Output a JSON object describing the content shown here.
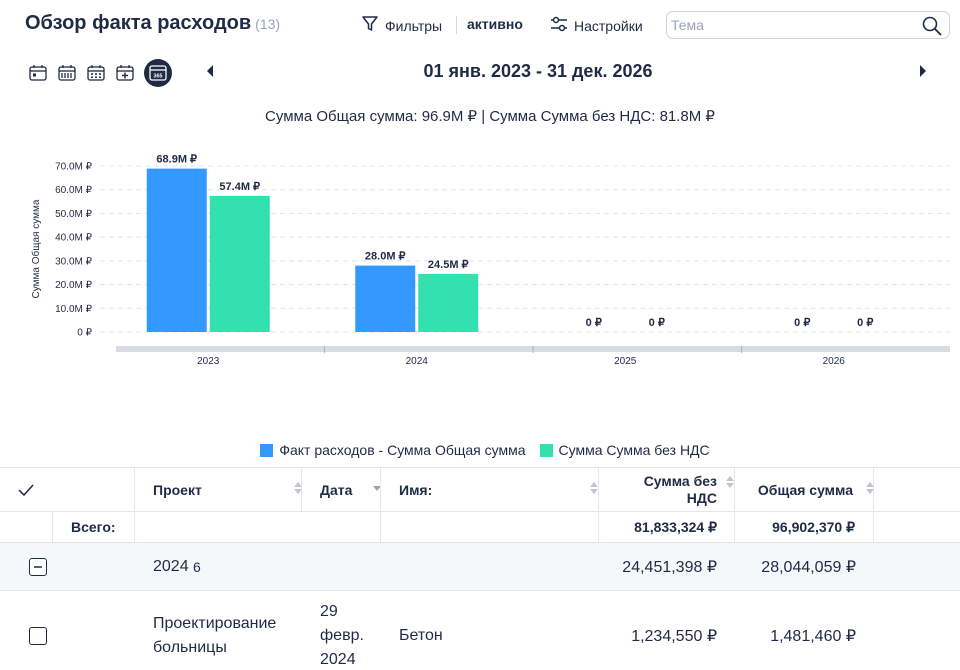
{
  "header": {
    "title": "Обзор факта расходов",
    "count": "(13)",
    "filters_label": "Фильтры",
    "filters_status": "активно",
    "settings_label": "Настройки",
    "search_placeholder": "Тема"
  },
  "period": {
    "range": "01 янв. 2023 - 31 дек. 2026",
    "icons": [
      "calendar-day-icon",
      "calendar-week-icon",
      "calendar-month-icon",
      "calendar-custom-icon",
      "calendar-year-icon"
    ],
    "active_icon_label": "365"
  },
  "chart_summary": "Сумма Общая сумма: 96.9M ₽ | Сумма Сумма без НДС: 81.8M ₽",
  "chart_data": {
    "type": "bar",
    "categories": [
      "2023",
      "2024",
      "2025",
      "2026"
    ],
    "series": [
      {
        "name": "Факт расходов - Сумма Общая сумма",
        "values": [
          68.9,
          28.0,
          0,
          0
        ],
        "labels": [
          "68.9M ₽",
          "28.0M ₽",
          "0 ₽",
          "0 ₽"
        ],
        "color": "#3399ff"
      },
      {
        "name": "Сумма Сумма без НДС",
        "values": [
          57.4,
          24.5,
          0,
          0
        ],
        "labels": [
          "57.4M ₽",
          "24.5M ₽",
          "0 ₽",
          "0 ₽"
        ],
        "color": "#33e0b0"
      }
    ],
    "ylabel": "Сумма Общая сумма",
    "yticks": [
      "0 ₽",
      "10.0M ₽",
      "20.0M ₽",
      "30.0M ₽",
      "40.0M ₽",
      "50.0M ₽",
      "60.0M ₽",
      "70.0M ₽"
    ],
    "ylim": [
      0,
      70
    ],
    "grid": true,
    "legend_position": "bottom"
  },
  "table": {
    "columns": {
      "project": "Проект",
      "date": "Дата",
      "name": "Имя:",
      "no_vat_line1": "Сумма без",
      "no_vat_line2": "НДС",
      "total": "Общая сумма"
    },
    "totals": {
      "label": "Всего:",
      "no_vat": "81,833,324 ₽",
      "total": "96,902,370 ₽"
    },
    "group": {
      "label": "2024",
      "count": "6",
      "no_vat": "24,451,398 ₽",
      "total": "28,044,059 ₽"
    },
    "rows": [
      {
        "project_line1": "Проектирование",
        "project_line2": "больницы",
        "date_line1": "29",
        "date_line2": "февр.",
        "date_line3": "2024",
        "name": "Бетон",
        "no_vat": "1,234,550 ₽",
        "total": "1,481,460 ₽"
      }
    ]
  },
  "colors": {
    "primary": "#1f2a44",
    "blue": "#3399ff",
    "teal": "#33e0b0"
  }
}
